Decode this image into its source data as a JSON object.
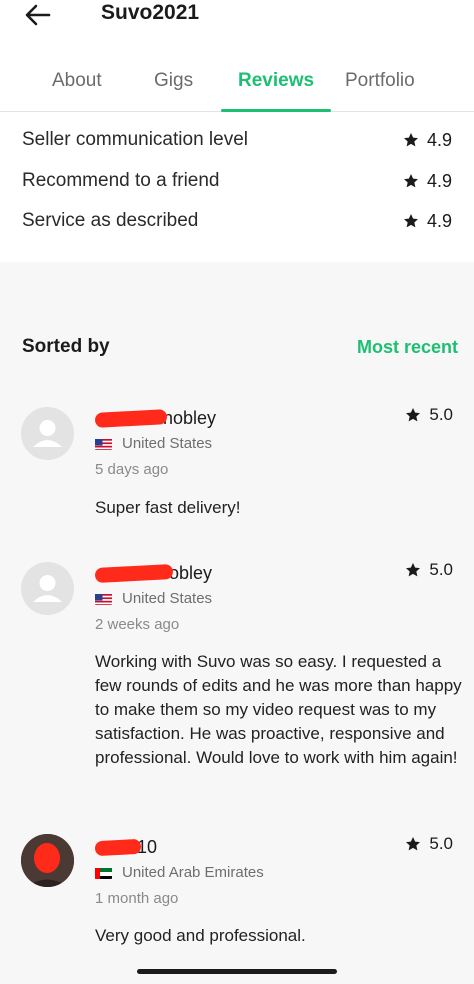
{
  "header": {
    "title": "Suvo2021"
  },
  "tabs": [
    {
      "label": "About"
    },
    {
      "label": "Gigs"
    },
    {
      "label": "Reviews"
    },
    {
      "label": "Portfolio"
    }
  ],
  "ratings": [
    {
      "label": "Seller communication level",
      "value": "4.9"
    },
    {
      "label": "Recommend to a friend",
      "value": "4.9"
    },
    {
      "label": "Service as described",
      "value": "4.9"
    }
  ],
  "sort": {
    "label": "Sorted by",
    "value": "Most recent"
  },
  "reviews": [
    {
      "name": "nobley",
      "country": "United States",
      "time": "5 days ago",
      "rating": "5.0",
      "text": "Super fast delivery!"
    },
    {
      "name": "obley",
      "country": "United States",
      "time": "2 weeks ago",
      "rating": "5.0",
      "text": "Working with Suvo was so easy. I requested a few rounds of edits and he was more than happy to make them so my video request was to my satisfaction. He was proactive, responsive and professional. Would love to work with him again!"
    },
    {
      "name": "10",
      "country": "United Arab Emirates",
      "time": "1 month ago",
      "rating": "5.0",
      "text": "Very good and professional."
    }
  ],
  "colors": {
    "accent": "#1dbf73",
    "redaction": "#ff2a1a"
  }
}
